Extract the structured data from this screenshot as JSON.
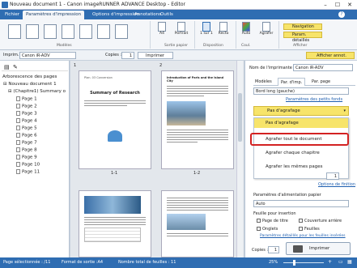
{
  "app": {
    "title": "Nouveau document 1 - Canon imageRUNNER ADVANCE Desktop - Editor"
  },
  "tabs": [
    "Fichier",
    "Paramètres d'impression",
    "Options d'impression",
    "Annotations",
    "Outils"
  ],
  "ribbon": {
    "groups": [
      "Modèles",
      "Sortie papier",
      "Disposition",
      "Coul.",
      "Afficher"
    ],
    "buttons": {
      "a4": "A4",
      "portrait": "Portrait",
      "one_page": "1 sur 1",
      "recto": "Recto",
      "auto": "Auto",
      "agrafer": "Agrafer",
      "navigation": "Navigation",
      "param_details": "Param. détaillés"
    }
  },
  "toolbar": {
    "imprimer_label": "Imprim.",
    "printer": "Canon iR-ADV",
    "copies_label": "Copies :",
    "copies": "1",
    "imprimer_btn": "Imprimer",
    "afficher_annot": "Afficher annot."
  },
  "left": {
    "title": "Arborescence des pages",
    "root": "Nouveau document 1",
    "chapter": "(Chapitre1) Summary o",
    "pages": [
      "Page 1",
      "Page 2",
      "Page 3",
      "Page 4",
      "Page 5",
      "Page 6",
      "Page 7",
      "Page 8",
      "Page 9",
      "Page 10",
      "Page 11"
    ]
  },
  "center": {
    "markers": [
      "1",
      "2"
    ],
    "labels": [
      "1-1",
      "1-2"
    ],
    "doc1_title": "Summary of Research",
    "doc1_head": "Plan. 03 Conversion",
    "doc2_head": "Introduction of Paris and the Island City"
  },
  "right": {
    "printer_label": "Nom de l'imprimante :",
    "printer": "Canon iR-ADV",
    "subtabs": [
      "Modèles",
      "Par. d'imp.",
      "Par. page"
    ],
    "binding": "Bord long (gauche)",
    "link_small": "Paramètres des petits fonds",
    "staple_header": "Pas d'agrafage",
    "menu": [
      "Pas d'agrafage",
      "Agrafer tout le document",
      "Agrafer chaque chapitre",
      "Agrafer les mêmes pages"
    ],
    "spinner": "1",
    "link_finition": "Options de finition",
    "paper_source_label": "Paramètres d'alimentation papier",
    "paper_source": "Auto",
    "insertion_label": "Feuille pour insertion",
    "cb_title": "Page de titre",
    "cb_cover": "Couverture arrière",
    "cb_tabs": "Onglets",
    "cb_sheets": "Feuilles",
    "link_insert": "Paramètres détaillés pour les feuilles insérées",
    "copies_label": "Copies :",
    "copies": "1",
    "print_btn": "Imprimer"
  },
  "status": {
    "selected": "Page sélectionnée : /11",
    "format": "Format de sortie :A4",
    "total": "Nombre total de feuilles : 11",
    "zoom": "25%"
  },
  "colors": {
    "accent": "#2f6db2",
    "highlight": "#f7e46a",
    "focus": "#d32222"
  }
}
